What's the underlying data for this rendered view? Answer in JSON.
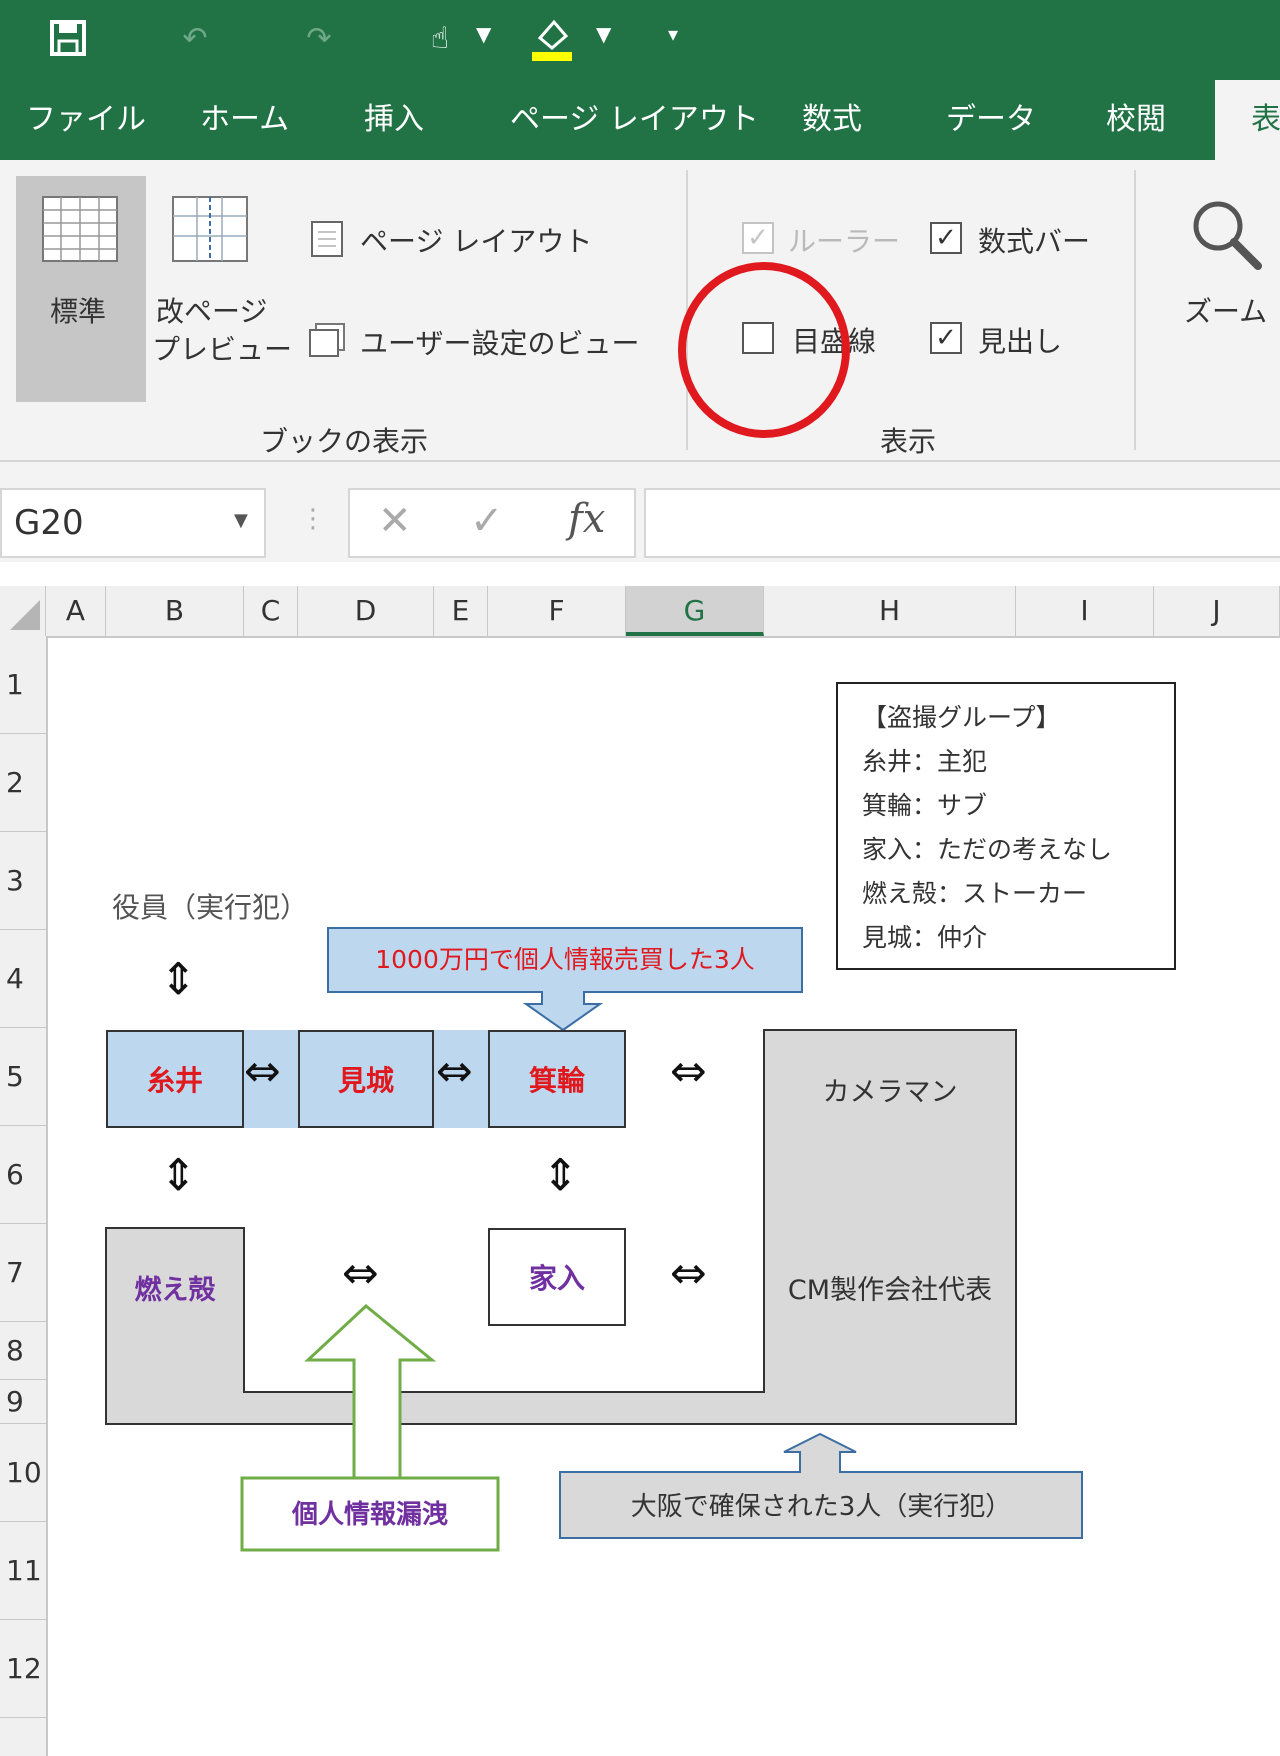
{
  "tabs": [
    "ファイル",
    "ホーム",
    "挿入",
    "ページ レイアウト",
    "数式",
    "データ",
    "校閲",
    "表"
  ],
  "ribbon": {
    "normal_label": "標準",
    "page_break_label_1": "改ページ",
    "page_break_label_2": "プレビュー",
    "page_layout_label": "ページ レイアウト",
    "custom_view_label": "ユーザー設定のビュー",
    "workbook_group_label": "ブックの表示",
    "ruler_label": "ルーラー",
    "formula_bar_label": "数式バー",
    "gridlines_label": "目盛線",
    "headings_label": "見出し",
    "show_group_label": "表示",
    "zoom_label": "ズーム"
  },
  "formula_bar": {
    "name_box": "G20",
    "fx_label": "fx",
    "value": ""
  },
  "columns": [
    "A",
    "B",
    "C",
    "D",
    "E",
    "F",
    "G",
    "H",
    "I",
    "J"
  ],
  "rows": [
    "1",
    "2",
    "3",
    "4",
    "5",
    "6",
    "7",
    "8",
    "9",
    "10",
    "11",
    "12"
  ],
  "diagram": {
    "executives_label": "役員（実行犯）",
    "callout_top": "1000万円で個人情報売買した3人",
    "itoi": "糸井",
    "mishiro": "見城",
    "minowa": "箕輪",
    "cameraman": "カメラマン",
    "moegara": "燃え殻",
    "iein": "家入",
    "cm_rep": "CM製作会社代表",
    "leak_label": "個人情報漏洩",
    "osaka_label": "大阪で確保された3人（実行犯）",
    "arrow_lr": "⇔",
    "arrow_ud": "⇕"
  },
  "legend": {
    "title": "【盗撮グループ】",
    "items": [
      "糸井：主犯",
      "箕輪：サブ",
      "家入：ただの考えなし",
      "燃え殻：ストーカー",
      "見城：仲介"
    ]
  },
  "colors": {
    "excel_green": "#217346",
    "highlight_red": "#e0191e",
    "purple_text": "#7030a0"
  }
}
